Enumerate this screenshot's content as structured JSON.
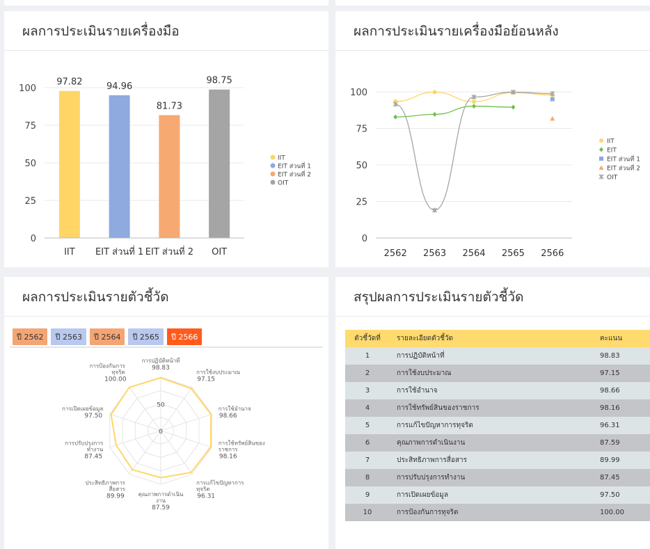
{
  "panel_bar": {
    "title": "ผลการประเมินรายเครื่องมือ"
  },
  "panel_line": {
    "title": "ผลการประเมินรายเครื่องมือย้อนหลัง"
  },
  "panel_radar": {
    "title": "ผลการประเมินรายตัวชี้วัด"
  },
  "panel_table": {
    "title": "สรุปผลการประเมินรายตัวชี้วัด"
  },
  "year_tabs": [
    {
      "label": "ปี 2562",
      "color": "#f4a574"
    },
    {
      "label": "ปี 2563",
      "color": "#b9c8ee"
    },
    {
      "label": "ปี 2564",
      "color": "#f4a574"
    },
    {
      "label": "ปี 2565",
      "color": "#b9c8ee"
    },
    {
      "label": "ปี 2566",
      "color": "#ff5b1c"
    }
  ],
  "chart_data": [
    {
      "type": "bar",
      "categories": [
        "IIT",
        "EIT ส่วนที่ 1",
        "EIT ส่วนที่ 2",
        "OIT"
      ],
      "values": [
        97.82,
        94.96,
        81.73,
        98.75
      ],
      "value_labels": [
        "97.82",
        "94.96",
        "81.73",
        "98.75"
      ],
      "colors": [
        "#ffd666",
        "#8eaadf",
        "#f6a970",
        "#a5a5a5"
      ],
      "legend": [
        "IIT",
        "EIT ส่วนที่ 1",
        "EIT ส่วนที่ 2",
        "OIT"
      ],
      "legend_placement": "right",
      "ylim": [
        0,
        100
      ],
      "yticks": [
        "0",
        "25",
        "50",
        "75",
        "100"
      ],
      "grid": true
    },
    {
      "type": "line",
      "x": [
        "2562",
        "2563",
        "2564",
        "2565",
        "2566"
      ],
      "ylim": [
        0,
        100
      ],
      "yticks": [
        "0",
        "25",
        "50",
        "75",
        "100"
      ],
      "grid": true,
      "legend_placement": "right",
      "series": [
        {
          "name": "IIT",
          "color": "#ffd666",
          "marker": "circle",
          "values": [
            93.5,
            99.8,
            93.3,
            99.5,
            97.82
          ]
        },
        {
          "name": "EIT",
          "color": "#6cc04a",
          "marker": "diamond",
          "values": [
            82.8,
            84.6,
            90.2,
            89.5,
            null
          ]
        },
        {
          "name": "EIT ส่วนที่ 1",
          "color": "#8eaadf",
          "marker": "square",
          "values": [
            null,
            null,
            null,
            null,
            94.96
          ]
        },
        {
          "name": "EIT ส่วนที่ 2",
          "color": "#f6a970",
          "marker": "triangle",
          "values": [
            null,
            null,
            null,
            null,
            81.73
          ]
        },
        {
          "name": "OIT",
          "color": "#a5a5a5",
          "marker": "star",
          "values": [
            91.5,
            19.0,
            96.5,
            99.8,
            98.75
          ]
        }
      ]
    },
    {
      "type": "radar",
      "max": 100,
      "rings": [
        "50",
        "0"
      ],
      "axes": [
        {
          "label": [
            "การปฏิบัติหน้าที่"
          ],
          "value": 98.83,
          "value_label": "98.83"
        },
        {
          "label": [
            "การใช้งบประมาณ"
          ],
          "value": 97.15,
          "value_label": "97.15"
        },
        {
          "label": [
            "การใช้อำนาจ"
          ],
          "value": 98.66,
          "value_label": "98.66"
        },
        {
          "label": [
            "การใช้ทรัพย์สินของ",
            "ราชการ"
          ],
          "value": 98.16,
          "value_label": "98.16"
        },
        {
          "label": [
            "การแก้ไขปัญหาการ",
            "ทุจริต"
          ],
          "value": 96.31,
          "value_label": "96.31"
        },
        {
          "label": [
            "คุณภาพการดำเนิน",
            "งาน"
          ],
          "value": 87.59,
          "value_label": "87.59"
        },
        {
          "label": [
            "ประสิทธิภาพการ",
            "สื่อสาร"
          ],
          "value": 89.99,
          "value_label": "89.99"
        },
        {
          "label": [
            "การปรับปรุงการ",
            "ทำงาน"
          ],
          "value": 87.45,
          "value_label": "87.45"
        },
        {
          "label": [
            "การเปิดเผยข้อมูล"
          ],
          "value": 97.5,
          "value_label": "97.50"
        },
        {
          "label": [
            "การป้องกันการ",
            "ทุจริต"
          ],
          "value": 100.0,
          "value_label": "100.00"
        }
      ],
      "color": "#ffd666"
    }
  ],
  "summary_table": {
    "headers": {
      "no": "ตัวชี้วัดที่",
      "desc": "รายละเอียดตัวชี้วัด",
      "score": "คะแนน"
    },
    "rows": [
      {
        "no": "1",
        "desc": "การปฏิบัติหน้าที่",
        "score": "98.83"
      },
      {
        "no": "2",
        "desc": "การใช้งบประมาณ",
        "score": "97.15"
      },
      {
        "no": "3",
        "desc": "การใช้อำนาจ",
        "score": "98.66"
      },
      {
        "no": "4",
        "desc": "การใช้ทรัพย์สินของราชการ",
        "score": "98.16"
      },
      {
        "no": "5",
        "desc": "การแก้ไขปัญหาการทุจริต",
        "score": "96.31"
      },
      {
        "no": "6",
        "desc": "คุณภาพการดำเนินงาน",
        "score": "87.59"
      },
      {
        "no": "7",
        "desc": "ประสิทธิภาพการสื่อสาร",
        "score": "89.99"
      },
      {
        "no": "8",
        "desc": "การปรับปรุงการทำงาน",
        "score": "87.45"
      },
      {
        "no": "9",
        "desc": "การเปิดเผยข้อมูล",
        "score": "97.50"
      },
      {
        "no": "10",
        "desc": "การป้องกันการทุจริต",
        "score": "100.00"
      }
    ]
  }
}
